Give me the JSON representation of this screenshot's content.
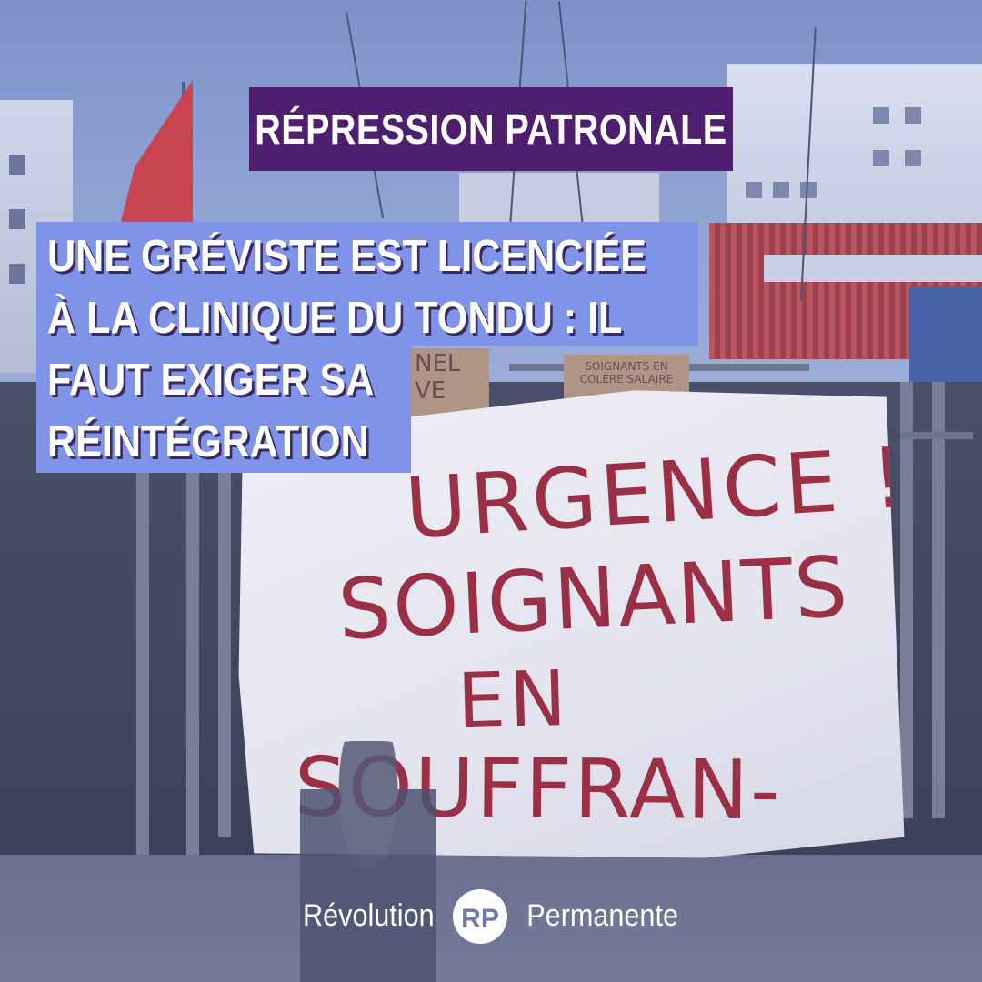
{
  "kicker": "RÉPRESSION PATRONALE",
  "headline": {
    "lines": [
      "UNE GRÉVISTE EST LICENCIÉE",
      "À LA CLINIQUE DU TONDU : IL",
      "FAUT EXIGER SA",
      "RÉINTÉGRATION"
    ]
  },
  "banner": {
    "lines": [
      "URGENCE !",
      "SOIGNANTS",
      "EN",
      "SOUFFRAN-"
    ]
  },
  "signs": {
    "left": "NEL VE",
    "right": "SOIGNANTS EN COLÈRE SALAIRE"
  },
  "brand": {
    "left_word": "Révolution",
    "logo_letters": "RP",
    "right_word": "Permanente"
  },
  "colors": {
    "kicker_bg": "#4e1f6e",
    "headline_bg": "#7f94e8",
    "banner_paint": "#9a2f45",
    "text": "#ffffff"
  }
}
